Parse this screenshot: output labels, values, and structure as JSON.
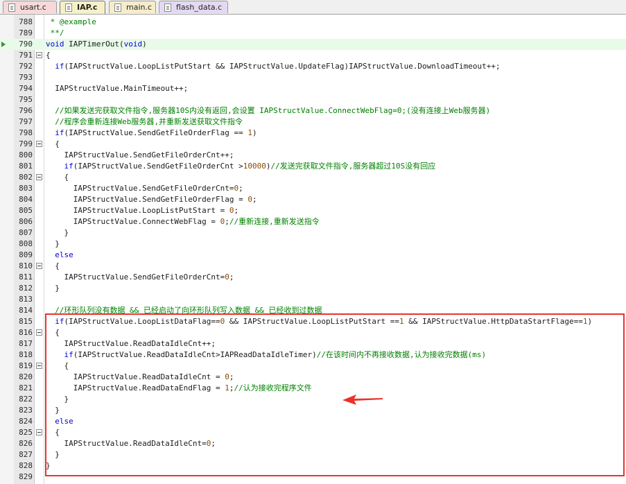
{
  "tabs": [
    {
      "label": "usart.c",
      "color": "#f7d9d9",
      "active": false
    },
    {
      "label": "IAP.c",
      "color": "#f6f0c8",
      "active": true
    },
    {
      "label": "main.c",
      "color": "#f6eccc",
      "active": false
    },
    {
      "label": "flash_data.c",
      "color": "#e4d9f2",
      "active": false
    }
  ],
  "editor": {
    "current_line": "790",
    "lines": [
      {
        "n": "788",
        "fold": false,
        "tokens": [
          {
            "t": " * @example",
            "c": "cm"
          }
        ]
      },
      {
        "n": "789",
        "fold": false,
        "tokens": [
          {
            "t": " **/",
            "c": "cm"
          }
        ]
      },
      {
        "n": "790",
        "fold": false,
        "tokens": [
          {
            "t": "void",
            "c": "kw"
          },
          {
            "t": " IAPTimerOut(",
            "c": ""
          },
          {
            "t": "void",
            "c": "kw"
          },
          {
            "t": ")",
            "c": ""
          }
        ]
      },
      {
        "n": "791",
        "fold": true,
        "tokens": [
          {
            "t": "{",
            "c": ""
          }
        ]
      },
      {
        "n": "792",
        "fold": false,
        "tokens": [
          {
            "t": "  ",
            "c": ""
          },
          {
            "t": "if",
            "c": "kw"
          },
          {
            "t": "(IAPStructValue.LoopListPutStart && IAPStructValue.UpdateFlag)IAPStructValue.DownloadTimeout++;",
            "c": ""
          }
        ]
      },
      {
        "n": "793",
        "fold": false,
        "tokens": []
      },
      {
        "n": "794",
        "fold": false,
        "tokens": [
          {
            "t": "  IAPStructValue.MainTimeout++;",
            "c": ""
          }
        ]
      },
      {
        "n": "795",
        "fold": false,
        "tokens": []
      },
      {
        "n": "796",
        "fold": false,
        "tokens": [
          {
            "t": "  //如果发送完获取文件指令,服务器10S内没有返回,会设置 IAPStructValue.ConnectWebFlag=0;(没有连接上Web服务器)",
            "c": "cm"
          }
        ]
      },
      {
        "n": "797",
        "fold": false,
        "tokens": [
          {
            "t": "  //程序会重新连接Web服务器,并重新发送获取文件指令",
            "c": "cm"
          }
        ]
      },
      {
        "n": "798",
        "fold": false,
        "tokens": [
          {
            "t": "  ",
            "c": ""
          },
          {
            "t": "if",
            "c": "kw"
          },
          {
            "t": "(IAPStructValue.SendGetFileOrderFlag == ",
            "c": ""
          },
          {
            "t": "1",
            "c": "num"
          },
          {
            "t": ")",
            "c": ""
          }
        ]
      },
      {
        "n": "799",
        "fold": true,
        "tokens": [
          {
            "t": "  {",
            "c": ""
          }
        ]
      },
      {
        "n": "800",
        "fold": false,
        "tokens": [
          {
            "t": "    IAPStructValue.SendGetFileOrderCnt++;",
            "c": ""
          }
        ]
      },
      {
        "n": "801",
        "fold": false,
        "tokens": [
          {
            "t": "    ",
            "c": ""
          },
          {
            "t": "if",
            "c": "kw"
          },
          {
            "t": "(IAPStructValue.SendGetFileOrderCnt >",
            "c": ""
          },
          {
            "t": "10000",
            "c": "num"
          },
          {
            "t": ")",
            "c": ""
          },
          {
            "t": "//发送完获取文件指令,服务器超过10S没有回应",
            "c": "cm"
          }
        ]
      },
      {
        "n": "802",
        "fold": true,
        "tokens": [
          {
            "t": "    {",
            "c": ""
          }
        ]
      },
      {
        "n": "803",
        "fold": false,
        "tokens": [
          {
            "t": "      IAPStructValue.SendGetFileOrderCnt=",
            "c": ""
          },
          {
            "t": "0",
            "c": "num"
          },
          {
            "t": ";",
            "c": ""
          }
        ]
      },
      {
        "n": "804",
        "fold": false,
        "tokens": [
          {
            "t": "      IAPStructValue.SendGetFileOrderFlag = ",
            "c": ""
          },
          {
            "t": "0",
            "c": "num"
          },
          {
            "t": ";",
            "c": ""
          }
        ]
      },
      {
        "n": "805",
        "fold": false,
        "tokens": [
          {
            "t": "      IAPStructValue.LoopListPutStart = ",
            "c": ""
          },
          {
            "t": "0",
            "c": "num"
          },
          {
            "t": ";",
            "c": ""
          }
        ]
      },
      {
        "n": "806",
        "fold": false,
        "tokens": [
          {
            "t": "      IAPStructValue.ConnectWebFlag = ",
            "c": ""
          },
          {
            "t": "0",
            "c": "num"
          },
          {
            "t": ";",
            "c": ""
          },
          {
            "t": "//重新连接,重新发送指令",
            "c": "cm"
          }
        ]
      },
      {
        "n": "807",
        "fold": false,
        "tokens": [
          {
            "t": "    }",
            "c": ""
          }
        ]
      },
      {
        "n": "808",
        "fold": false,
        "tokens": [
          {
            "t": "  }",
            "c": ""
          }
        ]
      },
      {
        "n": "809",
        "fold": false,
        "tokens": [
          {
            "t": "  ",
            "c": ""
          },
          {
            "t": "else",
            "c": "kw"
          }
        ]
      },
      {
        "n": "810",
        "fold": true,
        "tokens": [
          {
            "t": "  {",
            "c": ""
          }
        ]
      },
      {
        "n": "811",
        "fold": false,
        "tokens": [
          {
            "t": "    IAPStructValue.SendGetFileOrderCnt=",
            "c": ""
          },
          {
            "t": "0",
            "c": "num"
          },
          {
            "t": ";",
            "c": ""
          }
        ]
      },
      {
        "n": "812",
        "fold": false,
        "tokens": [
          {
            "t": "  }",
            "c": ""
          }
        ]
      },
      {
        "n": "813",
        "fold": false,
        "tokens": []
      },
      {
        "n": "814",
        "fold": false,
        "tokens": [
          {
            "t": "  //环形队列没有数据 && 已经启动了向环形队列写入数据 && 已经收到过数据",
            "c": "cm"
          }
        ]
      },
      {
        "n": "815",
        "fold": false,
        "tokens": [
          {
            "t": "  ",
            "c": ""
          },
          {
            "t": "if",
            "c": "kw"
          },
          {
            "t": "(IAPStructValue.LoopListDataFlag==",
            "c": ""
          },
          {
            "t": "0",
            "c": "num"
          },
          {
            "t": " && IAPStructValue.LoopListPutStart ==",
            "c": ""
          },
          {
            "t": "1",
            "c": "num"
          },
          {
            "t": " && IAPStructValue.HttpDataStartFlage==",
            "c": ""
          },
          {
            "t": "1",
            "c": "num"
          },
          {
            "t": ")",
            "c": ""
          }
        ]
      },
      {
        "n": "816",
        "fold": true,
        "tokens": [
          {
            "t": "  {",
            "c": ""
          }
        ]
      },
      {
        "n": "817",
        "fold": false,
        "tokens": [
          {
            "t": "    IAPStructValue.ReadDataIdleCnt++;",
            "c": ""
          }
        ]
      },
      {
        "n": "818",
        "fold": false,
        "tokens": [
          {
            "t": "    ",
            "c": ""
          },
          {
            "t": "if",
            "c": "kw"
          },
          {
            "t": "(IAPStructValue.ReadDataIdleCnt>IAPReadDataIdleTimer)",
            "c": ""
          },
          {
            "t": "//在该时间内不再接收数据,认为接收完数据(ms)",
            "c": "cm"
          }
        ]
      },
      {
        "n": "819",
        "fold": true,
        "tokens": [
          {
            "t": "    {",
            "c": ""
          }
        ]
      },
      {
        "n": "820",
        "fold": false,
        "tokens": [
          {
            "t": "      IAPStructValue.ReadDataIdleCnt = ",
            "c": ""
          },
          {
            "t": "0",
            "c": "num"
          },
          {
            "t": ";",
            "c": ""
          }
        ]
      },
      {
        "n": "821",
        "fold": false,
        "tokens": [
          {
            "t": "      IAPStructValue.ReadDataEndFlag = ",
            "c": ""
          },
          {
            "t": "1",
            "c": "num"
          },
          {
            "t": ";",
            "c": ""
          },
          {
            "t": "//认为接收完程序文件",
            "c": "cm"
          }
        ]
      },
      {
        "n": "822",
        "fold": false,
        "tokens": [
          {
            "t": "    }",
            "c": ""
          }
        ]
      },
      {
        "n": "823",
        "fold": false,
        "tokens": [
          {
            "t": "  }",
            "c": ""
          }
        ]
      },
      {
        "n": "824",
        "fold": false,
        "tokens": [
          {
            "t": "  ",
            "c": ""
          },
          {
            "t": "else",
            "c": "kw"
          }
        ]
      },
      {
        "n": "825",
        "fold": true,
        "tokens": [
          {
            "t": "  {",
            "c": ""
          }
        ]
      },
      {
        "n": "826",
        "fold": false,
        "tokens": [
          {
            "t": "    IAPStructValue.ReadDataIdleCnt=",
            "c": ""
          },
          {
            "t": "0",
            "c": "num"
          },
          {
            "t": ";",
            "c": ""
          }
        ]
      },
      {
        "n": "827",
        "fold": false,
        "tokens": [
          {
            "t": "  }",
            "c": ""
          }
        ]
      },
      {
        "n": "828",
        "fold": false,
        "tokens": [
          {
            "t": "}",
            "c": ""
          }
        ]
      },
      {
        "n": "829",
        "fold": false,
        "tokens": []
      }
    ]
  },
  "annotation": {
    "box_color": "#e8332c",
    "arrow_color": "#e8332c",
    "arrow_points_to_line": "821"
  }
}
